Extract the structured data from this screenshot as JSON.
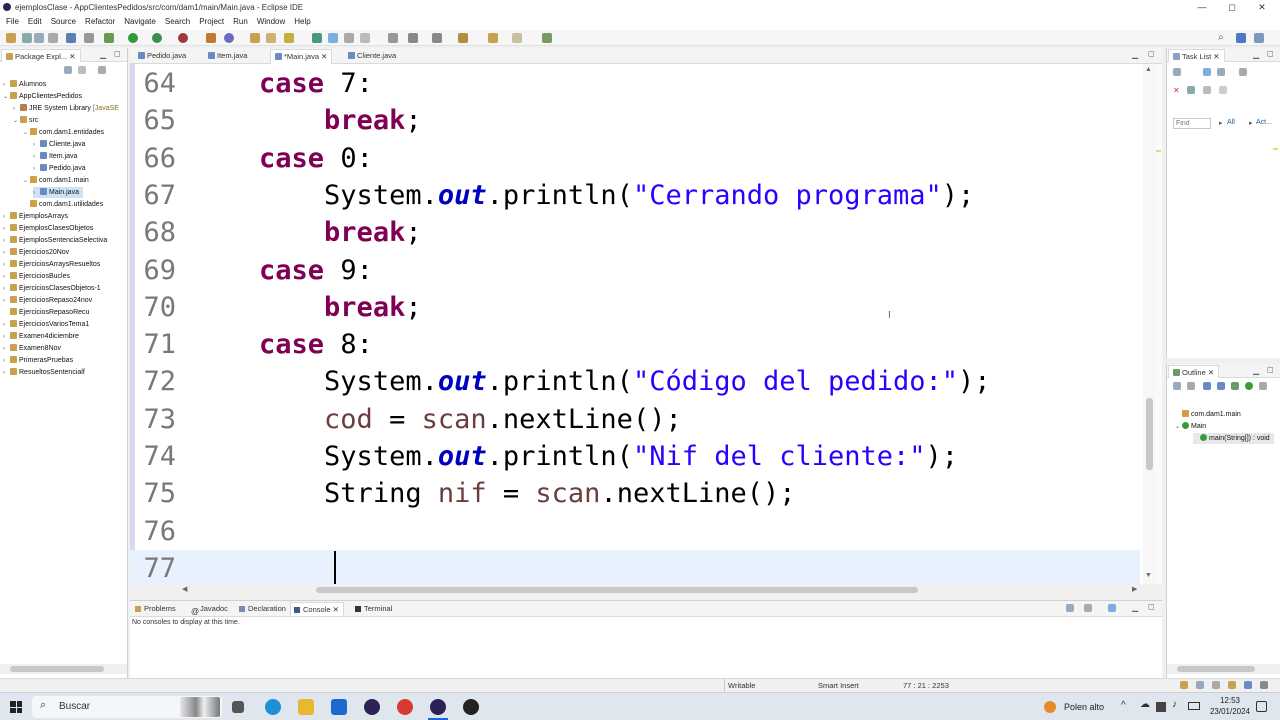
{
  "window": {
    "title": "ejemplosClase - AppClientesPedidos/src/com/dam1/main/Main.java - Eclipse IDE",
    "controls": [
      "—",
      "◻",
      "✕"
    ]
  },
  "menu": [
    "File",
    "Edit",
    "Source",
    "Refactor",
    "Navigate",
    "Search",
    "Project",
    "Run",
    "Window",
    "Help"
  ],
  "left_panel": {
    "tab": "Package Expl...",
    "tree": [
      {
        "label": "Alumnos",
        "level": 0,
        "twisty": "›",
        "icon": "project-icon"
      },
      {
        "label": "AppClientesPedidos",
        "level": 0,
        "twisty": "⌄",
        "icon": "project-icon"
      },
      {
        "label": "JRE System Library",
        "suffix": "[JavaSE",
        "level": 1,
        "twisty": "›",
        "icon": "library-icon"
      },
      {
        "label": "src",
        "level": 1,
        "twisty": "⌄",
        "icon": "source-folder-icon"
      },
      {
        "label": "com.dam1.entidades",
        "level": 2,
        "twisty": "⌄",
        "icon": "package-icon"
      },
      {
        "label": "Cliente.java",
        "level": 3,
        "twisty": "›",
        "icon": "java-file-icon"
      },
      {
        "label": "Item.java",
        "level": 3,
        "twisty": "›",
        "icon": "java-file-icon"
      },
      {
        "label": "Pedido.java",
        "level": 3,
        "twisty": "›",
        "icon": "java-file-icon"
      },
      {
        "label": "com.dam1.main",
        "level": 2,
        "twisty": "⌄",
        "icon": "package-icon"
      },
      {
        "label": "Main.java",
        "level": 3,
        "twisty": "›",
        "icon": "java-file-icon",
        "selected": true
      },
      {
        "label": "com.dam1.utilidades",
        "level": 2,
        "twisty": "",
        "icon": "package-icon"
      },
      {
        "label": "EjemplosArrays",
        "level": 0,
        "twisty": "›",
        "icon": "project-icon"
      },
      {
        "label": "EjemplosClasesObjetos",
        "level": 0,
        "twisty": "›",
        "icon": "project-icon"
      },
      {
        "label": "EjemplosSentenciaSelectiva",
        "level": 0,
        "twisty": "›",
        "icon": "project-icon"
      },
      {
        "label": "Ejercicios20Nov",
        "level": 0,
        "twisty": "›",
        "icon": "project-icon"
      },
      {
        "label": "EjerciciosArraysResueltos",
        "level": 0,
        "twisty": "›",
        "icon": "project-icon"
      },
      {
        "label": "EjerciciosBucles",
        "level": 0,
        "twisty": "›",
        "icon": "project-icon"
      },
      {
        "label": "EjerciciosClasesObjetos-1",
        "level": 0,
        "twisty": "›",
        "icon": "project-icon"
      },
      {
        "label": "EjerciciosRepaso24nov",
        "level": 0,
        "twisty": "›",
        "icon": "project-icon"
      },
      {
        "label": "EjerciciosRepasoRecu",
        "level": 0,
        "twisty": "",
        "icon": "project-icon"
      },
      {
        "label": "EjerciciosVariosTema1",
        "level": 0,
        "twisty": "›",
        "icon": "project-icon"
      },
      {
        "label": "Examen4diciembre",
        "level": 0,
        "twisty": "›",
        "icon": "project-icon"
      },
      {
        "label": "Examen8Nov",
        "level": 0,
        "twisty": "›",
        "icon": "project-icon"
      },
      {
        "label": "PrimerasPruebas",
        "level": 0,
        "twisty": "›",
        "icon": "project-icon"
      },
      {
        "label": "ResueltosSentencialf",
        "level": 0,
        "twisty": "›",
        "icon": "project-icon"
      }
    ]
  },
  "editor_tabs": [
    {
      "label": "Pedido.java",
      "active": false
    },
    {
      "label": "Item.java",
      "active": false
    },
    {
      "label": "*Main.java",
      "active": true
    },
    {
      "label": "Cliente.java",
      "active": false
    }
  ],
  "code_lines": [
    {
      "num": "64",
      "indent": "    ",
      "tokens": [
        {
          "t": "case",
          "c": "kw"
        },
        {
          "t": " 7:",
          "c": "plain"
        }
      ]
    },
    {
      "num": "65",
      "indent": "        ",
      "tokens": [
        {
          "t": "break",
          "c": "kw"
        },
        {
          "t": ";",
          "c": "plain"
        }
      ]
    },
    {
      "num": "66",
      "indent": "    ",
      "tokens": [
        {
          "t": "case",
          "c": "kw"
        },
        {
          "t": " 0:",
          "c": "plain"
        }
      ]
    },
    {
      "num": "67",
      "indent": "        ",
      "tokens": [
        {
          "t": "System.",
          "c": "plain"
        },
        {
          "t": "out",
          "c": "fld"
        },
        {
          "t": ".println(",
          "c": "plain"
        },
        {
          "t": "\"Cerrando programa\"",
          "c": "str"
        },
        {
          "t": ");",
          "c": "plain"
        }
      ]
    },
    {
      "num": "68",
      "indent": "        ",
      "tokens": [
        {
          "t": "break",
          "c": "kw"
        },
        {
          "t": ";",
          "c": "plain"
        }
      ]
    },
    {
      "num": "69",
      "indent": "    ",
      "tokens": [
        {
          "t": "case",
          "c": "kw"
        },
        {
          "t": " 9:",
          "c": "plain"
        }
      ]
    },
    {
      "num": "70",
      "indent": "        ",
      "tokens": [
        {
          "t": "break",
          "c": "kw"
        },
        {
          "t": ";",
          "c": "plain"
        }
      ]
    },
    {
      "num": "71",
      "indent": "    ",
      "tokens": [
        {
          "t": "case",
          "c": "kw"
        },
        {
          "t": " 8:",
          "c": "plain"
        }
      ]
    },
    {
      "num": "72",
      "indent": "        ",
      "tokens": [
        {
          "t": "System.",
          "c": "plain"
        },
        {
          "t": "out",
          "c": "fld"
        },
        {
          "t": ".println(",
          "c": "plain"
        },
        {
          "t": "\"Código del pedido:\"",
          "c": "str"
        },
        {
          "t": ");",
          "c": "plain"
        }
      ]
    },
    {
      "num": "73",
      "indent": "        ",
      "tokens": [
        {
          "t": "cod",
          "c": "var"
        },
        {
          "t": " = ",
          "c": "plain"
        },
        {
          "t": "scan",
          "c": "var"
        },
        {
          "t": ".nextLine();",
          "c": "plain"
        }
      ]
    },
    {
      "num": "74",
      "indent": "        ",
      "tokens": [
        {
          "t": "System.",
          "c": "plain"
        },
        {
          "t": "out",
          "c": "fld"
        },
        {
          "t": ".println(",
          "c": "plain"
        },
        {
          "t": "\"Nif del cliente:\"",
          "c": "str"
        },
        {
          "t": ");",
          "c": "plain"
        }
      ]
    },
    {
      "num": "75",
      "indent": "        ",
      "tokens": [
        {
          "t": "String ",
          "c": "plain"
        },
        {
          "t": "nif",
          "c": "var"
        },
        {
          "t": " = ",
          "c": "plain"
        },
        {
          "t": "scan",
          "c": "var"
        },
        {
          "t": ".nextLine();",
          "c": "plain"
        }
      ]
    },
    {
      "num": "76",
      "indent": "",
      "tokens": []
    },
    {
      "num": "77",
      "indent": "",
      "tokens": [],
      "current": true
    }
  ],
  "task_list": {
    "tab": "Task List",
    "find_placeholder": "Find",
    "all_label": "All",
    "activate_label": "Act..."
  },
  "outline": {
    "tab": "Outline",
    "items": [
      {
        "label": "com.dam1.main",
        "level": 0,
        "icon": "package-icon"
      },
      {
        "label": "Main",
        "level": 0,
        "icon": "class-icon",
        "twisty": "⌄"
      },
      {
        "label": "main(String[]) : void",
        "level": 1,
        "icon": "method-icon"
      }
    ]
  },
  "console": {
    "tabs": [
      {
        "label": "Problems",
        "icon": "problems-icon",
        "active": false
      },
      {
        "label": "Javadoc",
        "icon": "javadoc-icon",
        "active": false
      },
      {
        "label": "Declaration",
        "icon": "declaration-icon",
        "active": false
      },
      {
        "label": "Console",
        "icon": "console-icon",
        "active": true
      },
      {
        "label": "Terminal",
        "icon": "terminal-icon",
        "active": false
      }
    ],
    "message": "No consoles to display at this time."
  },
  "status": {
    "writable": "Writable",
    "insert_mode": "Smart Insert",
    "position": "77 : 21 : 2253"
  },
  "taskbar": {
    "search_placeholder": "Buscar",
    "weather": "Polen alto",
    "time": "12:53",
    "date": "23/01/2024"
  },
  "colors": {
    "keyword": "#7f0055",
    "string": "#2a00ff",
    "field": "#0000c0",
    "local_var": "#6a3e3e",
    "current_line": "#e8f2fe"
  }
}
